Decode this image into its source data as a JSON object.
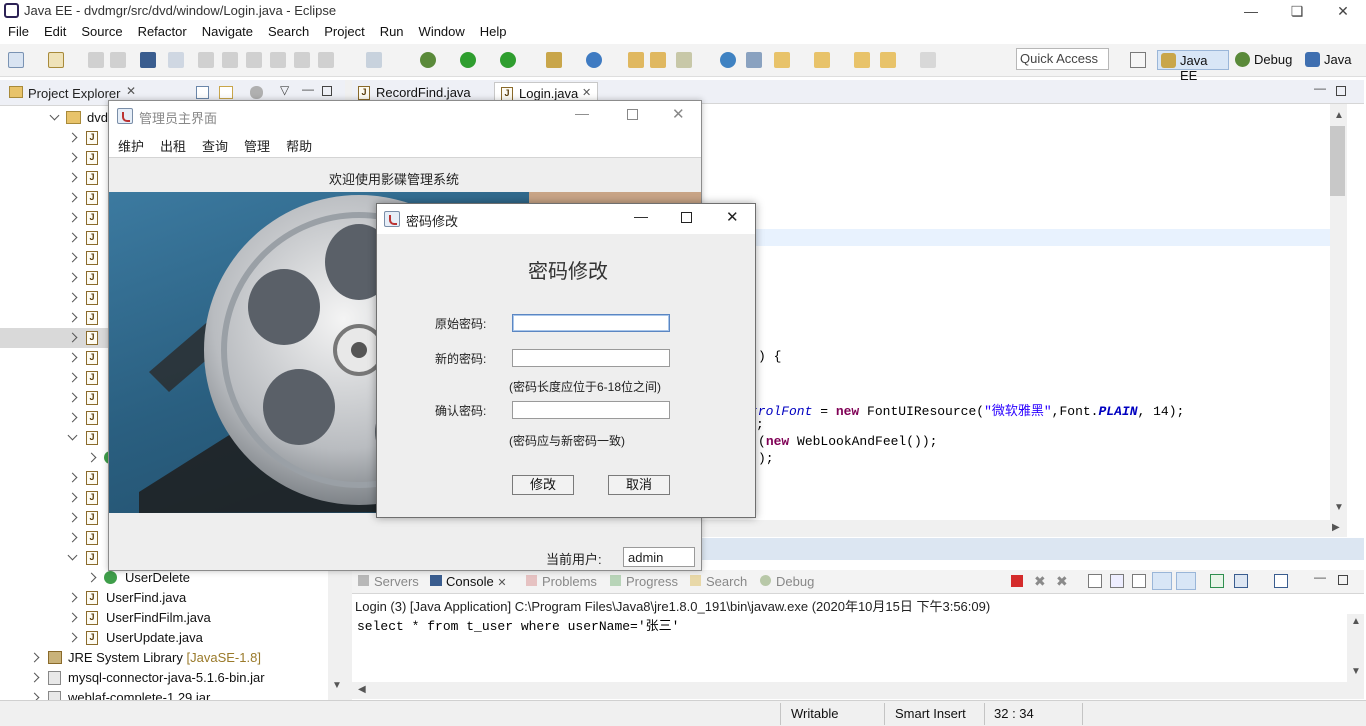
{
  "eclipse": {
    "title": "Java EE - dvdmgr/src/dvd/window/Login.java - Eclipse",
    "menu": [
      "File",
      "Edit",
      "Source",
      "Refactor",
      "Navigate",
      "Search",
      "Project",
      "Run",
      "Window",
      "Help"
    ],
    "quick_access_placeholder": "Quick Access",
    "perspectives": [
      "Java EE",
      "Debug",
      "Java"
    ]
  },
  "project_explorer": {
    "title": "Project Explorer",
    "root_label": "dvd",
    "items_visible": [
      "UserDelete",
      "UserFind.java",
      "UserFindFilm.java",
      "UserUpdate.java"
    ],
    "libraries": [
      {
        "name": "JRE System Library",
        "suffix": "[JavaSE-1.8]"
      },
      {
        "name": "mysql-connector-java-5.1.6-bin.jar",
        "suffix": ""
      },
      {
        "name": "weblaf-complete-1.29.jar",
        "suffix": ""
      }
    ]
  },
  "editor": {
    "tabs": [
      "RecordFind.java",
      "Login.java"
    ],
    "code_fragments": {
      "brace": ") {",
      "line1_field": "trolFont",
      "line1_eq": " = ",
      "line1_new": "new",
      "line1_class": " FontUIResource(",
      "line1_str": "\"微软雅黑\"",
      "line1_mid": ",Font.",
      "line1_const": "PLAIN",
      "line1_end": ", 14);",
      "line2": ";",
      "line3_open": "(",
      "line3_new": "new",
      "line3_rest": " WebLookAndFeel());",
      "line4": ");"
    }
  },
  "console": {
    "tabs": [
      "Servers",
      "Console",
      "Problems",
      "Progress",
      "Search",
      "Debug"
    ],
    "header": "Login (3) [Java Application] C:\\Program Files\\Java8\\jre1.8.0_191\\bin\\javaw.exe (2020年10月15日 下午3:56:09)",
    "output": "select * from t_user where userName='张三'"
  },
  "statusbar": {
    "writable": "Writable",
    "insert_mode": "Smart Insert",
    "position": "32 : 34"
  },
  "main_window": {
    "title": "管理员主界面",
    "menu": [
      "维护",
      "出租",
      "查询",
      "管理",
      "帮助"
    ],
    "welcome": "欢迎使用影碟管理系统",
    "current_user_label": "当前用户:",
    "current_user": "admin"
  },
  "password_dialog": {
    "title": "密码修改",
    "heading": "密码修改",
    "old_label": "原始密码:",
    "new_label": "新的密码:",
    "new_hint": "(密码长度应位于6-18位之间)",
    "confirm_label": "确认密码:",
    "confirm_hint": "(密码应与新密码一致)",
    "old_value": "",
    "new_value": "",
    "confirm_value": "",
    "ok_label": "修改",
    "cancel_label": "取消"
  },
  "colors": {
    "accent": "#2a6fc9",
    "highlight_line": "#e8f2fe",
    "film_bg": "#2a5f80"
  }
}
